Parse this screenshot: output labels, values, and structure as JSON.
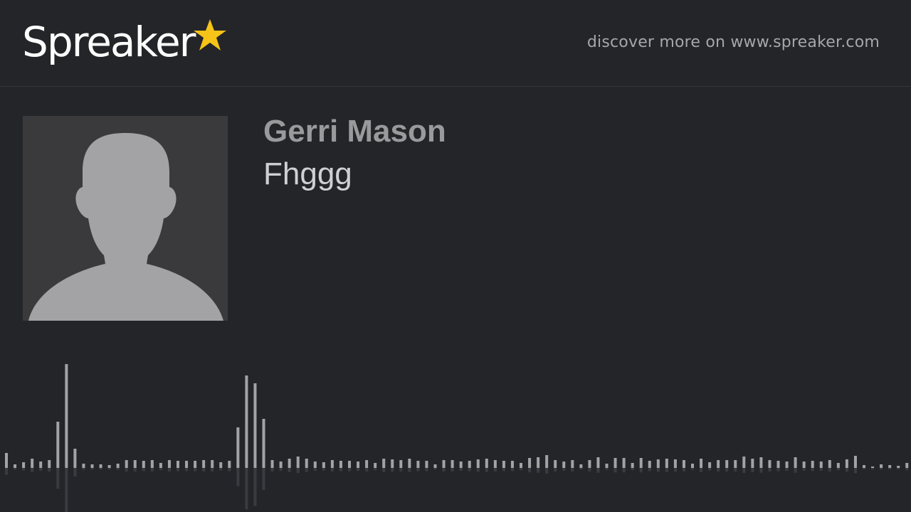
{
  "header": {
    "logo_text": "Spreaker",
    "logo_icon": "star-icon",
    "star_color": "#f6c318",
    "discover_text": "discover more on www.spreaker.com"
  },
  "episode": {
    "author": "Gerri Mason",
    "title": "Fhggg",
    "avatar_icon": "person-silhouette-icon"
  },
  "waveform": {
    "bar_color": "#a3a3a5",
    "levels": [
      21,
      5,
      8,
      13,
      9,
      11,
      65,
      146,
      27,
      6,
      5,
      5,
      4,
      6,
      11,
      11,
      10,
      11,
      7,
      11,
      10,
      10,
      10,
      11,
      11,
      8,
      10,
      57,
      130,
      119,
      69,
      11,
      9,
      13,
      16,
      13,
      9,
      8,
      11,
      10,
      10,
      9,
      11,
      7,
      13,
      12,
      11,
      13,
      10,
      10,
      5,
      11,
      11,
      9,
      10,
      12,
      13,
      11,
      10,
      10,
      7,
      14,
      15,
      18,
      11,
      9,
      11,
      5,
      11,
      15,
      6,
      14,
      14,
      7,
      14,
      10,
      12,
      13,
      12,
      11,
      6,
      13,
      8,
      11,
      11,
      11,
      16,
      13,
      15,
      11,
      10,
      9,
      15,
      9,
      10,
      9,
      11,
      7,
      12,
      17,
      4,
      2,
      5,
      4,
      3,
      7
    ]
  }
}
